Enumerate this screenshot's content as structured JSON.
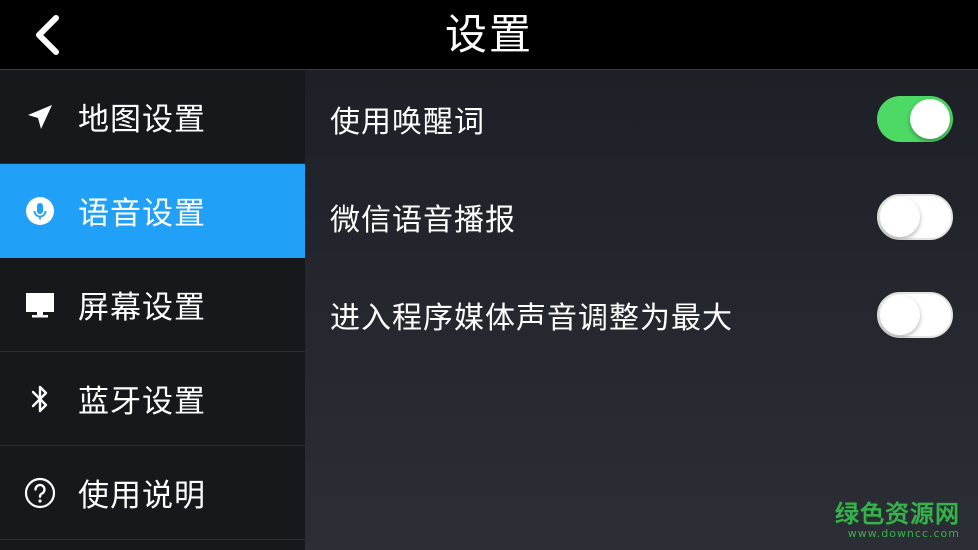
{
  "header": {
    "title": "设置",
    "back_icon": "chevron-left-icon"
  },
  "sidebar": {
    "items": [
      {
        "label": "地图设置",
        "icon": "navigation-arrow-icon",
        "active": false
      },
      {
        "label": "语音设置",
        "icon": "microphone-icon",
        "active": true
      },
      {
        "label": "屏幕设置",
        "icon": "monitor-icon",
        "active": false
      },
      {
        "label": "蓝牙设置",
        "icon": "bluetooth-icon",
        "active": false
      },
      {
        "label": "使用说明",
        "icon": "help-circle-icon",
        "active": false
      }
    ]
  },
  "main": {
    "settings": [
      {
        "label": "使用唤醒词",
        "enabled": true
      },
      {
        "label": "微信语音播报",
        "enabled": false
      },
      {
        "label": "进入程序媒体声音调整为最大",
        "enabled": false
      }
    ]
  },
  "watermark": {
    "brand": "绿色资源网",
    "url": "www.downcc.com"
  },
  "colors": {
    "active_blue": "#20a0f6",
    "toggle_green": "#4cd964",
    "header_bg": "#000000"
  }
}
